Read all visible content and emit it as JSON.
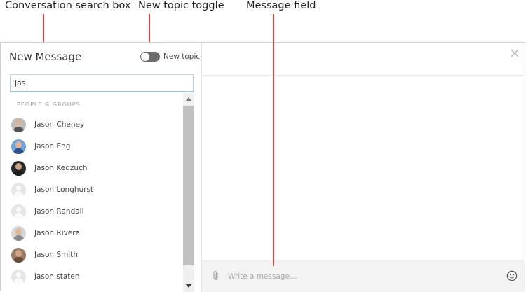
{
  "annotations": {
    "search_box": "Conversation search box",
    "new_topic_toggle": "New topic toggle",
    "message_field": "Message field"
  },
  "panel": {
    "title": "New Message",
    "new_topic_label": "New topic",
    "new_topic_on": false,
    "search_value": "jas",
    "section_label": "PEOPLE & GROUPS"
  },
  "results": [
    {
      "name": "Jason Cheney",
      "avatar": "photo"
    },
    {
      "name": "Jason Eng",
      "avatar": "photo"
    },
    {
      "name": "Jason Kedzuch",
      "avatar": "photo"
    },
    {
      "name": "Jason Longhurst",
      "avatar": "placeholder"
    },
    {
      "name": "Jason Randall",
      "avatar": "placeholder"
    },
    {
      "name": "Jason Rivera",
      "avatar": "photo"
    },
    {
      "name": "Jason Smith",
      "avatar": "photo"
    },
    {
      "name": "jason.staten",
      "avatar": "placeholder"
    }
  ],
  "compose": {
    "placeholder": "Write a message..."
  },
  "icons": {
    "close": "close-icon",
    "attach": "paperclip-icon",
    "emoji": "smiley-icon"
  },
  "colors": {
    "annotation_line": "#d64545",
    "toggle_off": "#6d6d6d",
    "search_focus": "#9ec2df"
  }
}
